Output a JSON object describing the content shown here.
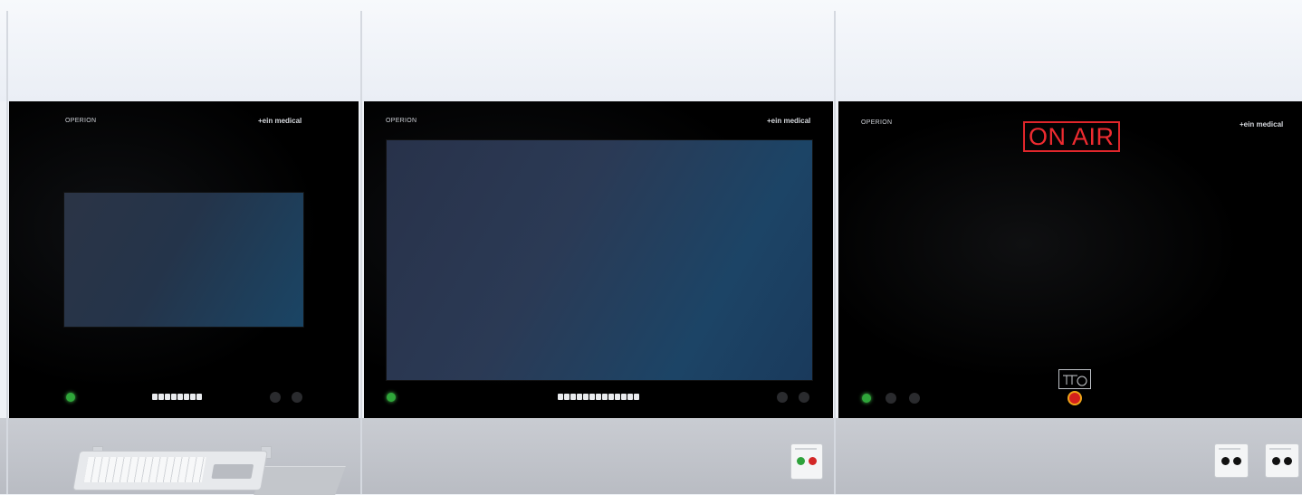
{
  "panels": [
    {
      "brand": "OPERION",
      "logo": "+ein medical",
      "screen": "small",
      "indicators": [
        "green",
        "dark",
        "dark"
      ],
      "keypad_keys": 8
    },
    {
      "brand": "OPERION",
      "logo": "+ein medical",
      "screen": "large",
      "indicators": [
        "green",
        "dark",
        "dark"
      ],
      "keypad_keys": 13
    },
    {
      "brand": "OPERION",
      "logo": "+ein medical",
      "sign": "ON AIR",
      "indicators": [
        "green",
        "dark",
        "dark"
      ],
      "emergency_stop": true
    }
  ],
  "colors": {
    "panel_bg": "#000000",
    "on_air_red": "#ee2b30",
    "led_green": "#2fa63a",
    "screen_blue": "#1a4565",
    "wall": "#eef1f6",
    "counter": "#c3c6cb"
  },
  "icons": [
    "emergency-stop-pictogram-icon",
    "emergency-stop-button-icon",
    "power-socket-icon"
  ]
}
